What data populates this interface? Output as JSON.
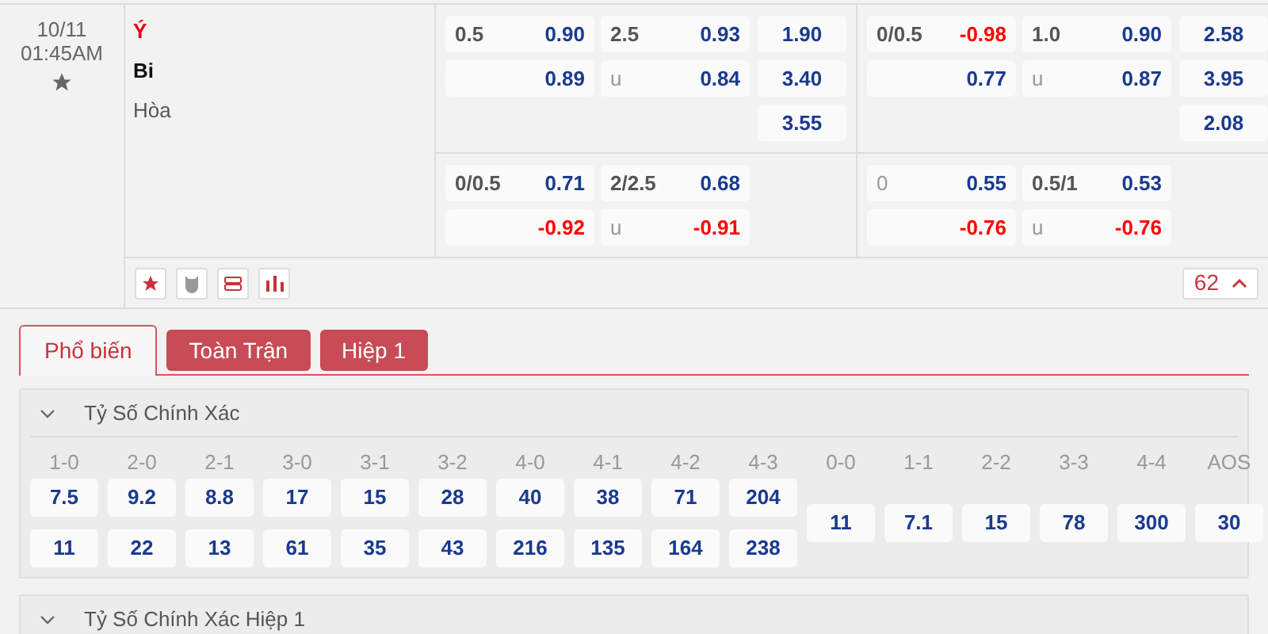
{
  "match": {
    "date": "10/11",
    "time": "01:45AM",
    "teams": [
      {
        "name": "Ý",
        "kind": "home"
      },
      {
        "name": "Bi",
        "kind": "away"
      },
      {
        "name": "Hòa",
        "kind": "draw"
      }
    ],
    "blocks": [
      {
        "groups": [
          {
            "handicap": [
              {
                "line": "0.5",
                "odds": "0.90",
                "negative": false
              },
              {
                "odds": "0.89",
                "negative": false
              }
            ],
            "over_under": [
              {
                "line": "2.5",
                "odds": "0.93",
                "negative": false
              },
              {
                "line": "u",
                "odds": "0.84",
                "negative": false
              }
            ],
            "moneyline": [
              "1.90",
              "3.40",
              "3.55"
            ]
          },
          {
            "handicap": [
              {
                "line": "0/0.5",
                "odds": "-0.98",
                "negative": true
              },
              {
                "odds": "0.77",
                "negative": false
              }
            ],
            "over_under": [
              {
                "line": "1.0",
                "odds": "0.90",
                "negative": false
              },
              {
                "line": "u",
                "odds": "0.87",
                "negative": false
              }
            ],
            "moneyline": [
              "2.58",
              "3.95",
              "2.08"
            ]
          }
        ]
      },
      {
        "groups": [
          {
            "handicap": [
              {
                "line": "0/0.5",
                "odds": "0.71",
                "negative": false
              },
              {
                "odds": "-0.92",
                "negative": true
              }
            ],
            "over_under": [
              {
                "line": "2/2.5",
                "odds": "0.68",
                "negative": false
              },
              {
                "line": "u",
                "odds": "-0.91",
                "negative": true
              }
            ]
          },
          {
            "handicap": [
              {
                "line": "0",
                "odds": "0.55",
                "negative": false
              },
              {
                "odds": "-0.76",
                "negative": true
              }
            ],
            "over_under": [
              {
                "line": "0.5/1",
                "odds": "0.53",
                "negative": false
              },
              {
                "line": "u",
                "odds": "-0.76",
                "negative": true
              }
            ]
          }
        ]
      }
    ],
    "more_count": "62"
  },
  "tabs": [
    {
      "label": "Phổ biến",
      "selected": true
    },
    {
      "label": "Toàn Trận",
      "selected": false
    },
    {
      "label": "Hiệp 1",
      "selected": false
    }
  ],
  "sections": [
    {
      "title": "Tỷ Số Chính Xác",
      "expanded": true,
      "columns": [
        {
          "score": "1-0",
          "odds": [
            "7.5",
            "11"
          ]
        },
        {
          "score": "2-0",
          "odds": [
            "9.2",
            "22"
          ]
        },
        {
          "score": "2-1",
          "odds": [
            "8.8",
            "13"
          ]
        },
        {
          "score": "3-0",
          "odds": [
            "17",
            "61"
          ]
        },
        {
          "score": "3-1",
          "odds": [
            "15",
            "35"
          ]
        },
        {
          "score": "3-2",
          "odds": [
            "28",
            "43"
          ]
        },
        {
          "score": "4-0",
          "odds": [
            "40",
            "216"
          ]
        },
        {
          "score": "4-1",
          "odds": [
            "38",
            "135"
          ]
        },
        {
          "score": "4-2",
          "odds": [
            "71",
            "164"
          ]
        },
        {
          "score": "4-3",
          "odds": [
            "204",
            "238"
          ]
        },
        {
          "score": "0-0",
          "odds": [
            "11"
          ]
        },
        {
          "score": "1-1",
          "odds": [
            "7.1"
          ]
        },
        {
          "score": "2-2",
          "odds": [
            "15"
          ]
        },
        {
          "score": "3-3",
          "odds": [
            "78"
          ]
        },
        {
          "score": "4-4",
          "odds": [
            "300"
          ]
        },
        {
          "score": "AOS",
          "odds": [
            "30"
          ]
        }
      ]
    },
    {
      "title": "Tỷ Số Chính Xác Hiệp 1",
      "expanded": true
    }
  ]
}
